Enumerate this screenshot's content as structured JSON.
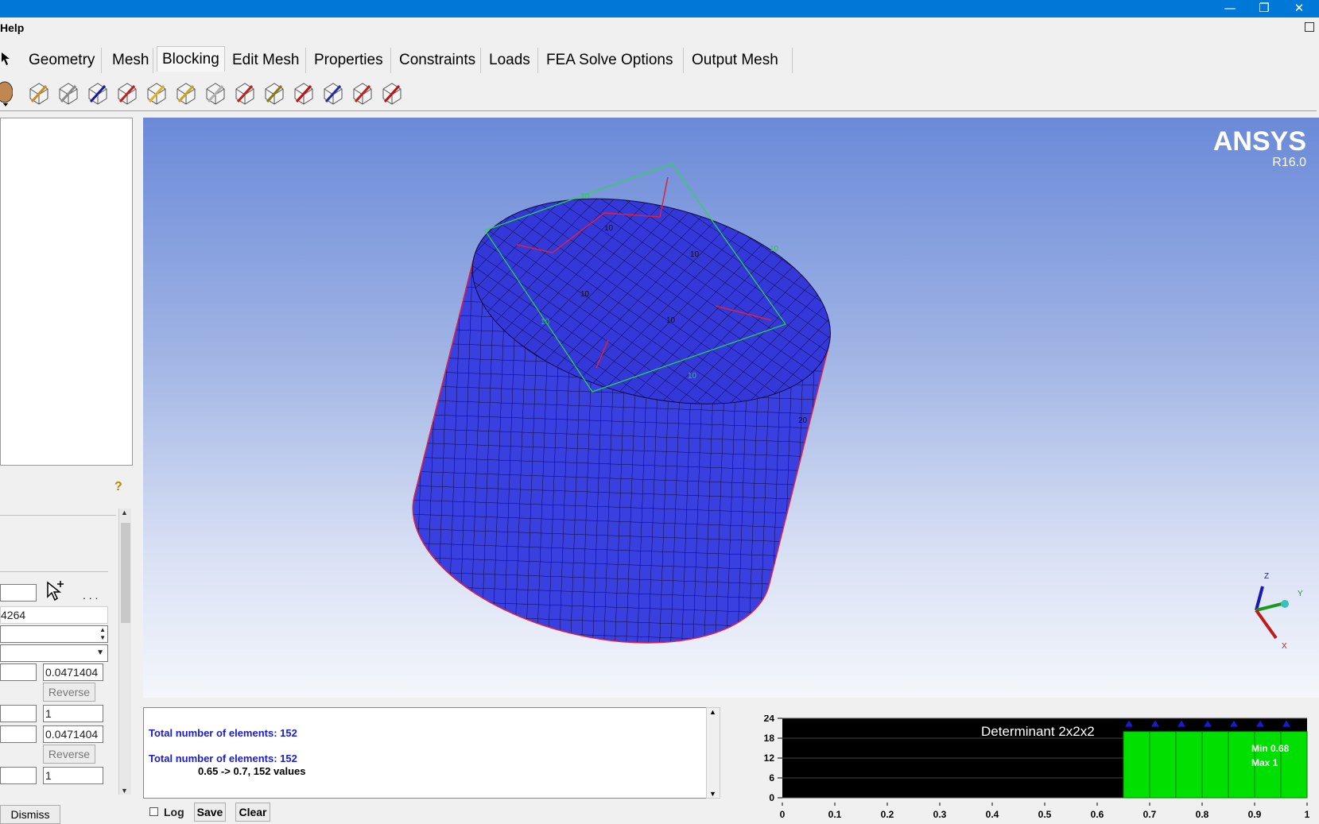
{
  "window": {
    "minimize": "—",
    "restore": "❐",
    "close": "✕"
  },
  "menu": {
    "help": "Help"
  },
  "tabs": [
    "Geometry",
    "Mesh",
    "Blocking",
    "Edit Mesh",
    "Properties",
    "Constraints",
    "Loads",
    "FEA Solve Options",
    "Output Mesh"
  ],
  "active_tab": "Blocking",
  "toolbar_icons": [
    "create-block-icon",
    "split-block-icon",
    "merge-vertices-icon",
    "edit-block-icon",
    "associate-icon",
    "move-vertex-icon",
    "transform-blocks-icon",
    "edit-edge-icon",
    "pre-mesh-params-icon",
    "pre-mesh-quality-icon",
    "pre-mesh-smooth-icon",
    "check-blocks-icon",
    "delete-block-icon"
  ],
  "params": {
    "field_partial": "4264",
    "spacing1": "0.0471404",
    "reverse1": "Reverse",
    "ratio1": "1",
    "spacing2": "0.0471404",
    "reverse2": "Reverse",
    "ratio2": "1",
    "dots": ". . ."
  },
  "dismiss": "Dismiss",
  "viewport": {
    "brand": "ANSYS",
    "version": "R16.0",
    "edge_labels": [
      "10",
      "10",
      "10",
      "10",
      "10",
      "10",
      "10",
      "10",
      "20"
    ],
    "axes": {
      "x": "X",
      "y": "Y",
      "z": "Z"
    }
  },
  "messages": [
    {
      "text": "Total number of elements: 152",
      "color": "#1a1ad0"
    },
    {
      "text": "Total number of elements: 152",
      "color": "#1a1ad0"
    },
    {
      "text": "0.65 -> 0.7, 152 values",
      "color": "#000000"
    }
  ],
  "msg_controls": {
    "log": "Log",
    "save": "Save",
    "clear": "Clear"
  },
  "chart_data": {
    "type": "bar",
    "title": "Determinant 2x2x2",
    "x_ticks": [
      "0",
      "0.1",
      "0.2",
      "0.3",
      "0.4",
      "0.5",
      "0.6",
      "0.7",
      "0.8",
      "0.9",
      "1"
    ],
    "y_ticks": [
      "0",
      "6",
      "12",
      "18",
      "24"
    ],
    "ylim": [
      0,
      24
    ],
    "xlim": [
      0,
      1
    ],
    "bins": [
      {
        "from": 0.65,
        "to": 0.7,
        "value": 20
      },
      {
        "from": 0.7,
        "to": 0.75,
        "value": 20
      },
      {
        "from": 0.75,
        "to": 0.8,
        "value": 20
      },
      {
        "from": 0.8,
        "to": 0.85,
        "value": 20
      },
      {
        "from": 0.85,
        "to": 0.9,
        "value": 20
      },
      {
        "from": 0.9,
        "to": 0.95,
        "value": 20
      },
      {
        "from": 0.95,
        "to": 1.0,
        "value": 20
      }
    ],
    "min_label": "Min 0.68",
    "max_label": "Max 1",
    "bar_color": "#00e000",
    "background": "#000000"
  }
}
